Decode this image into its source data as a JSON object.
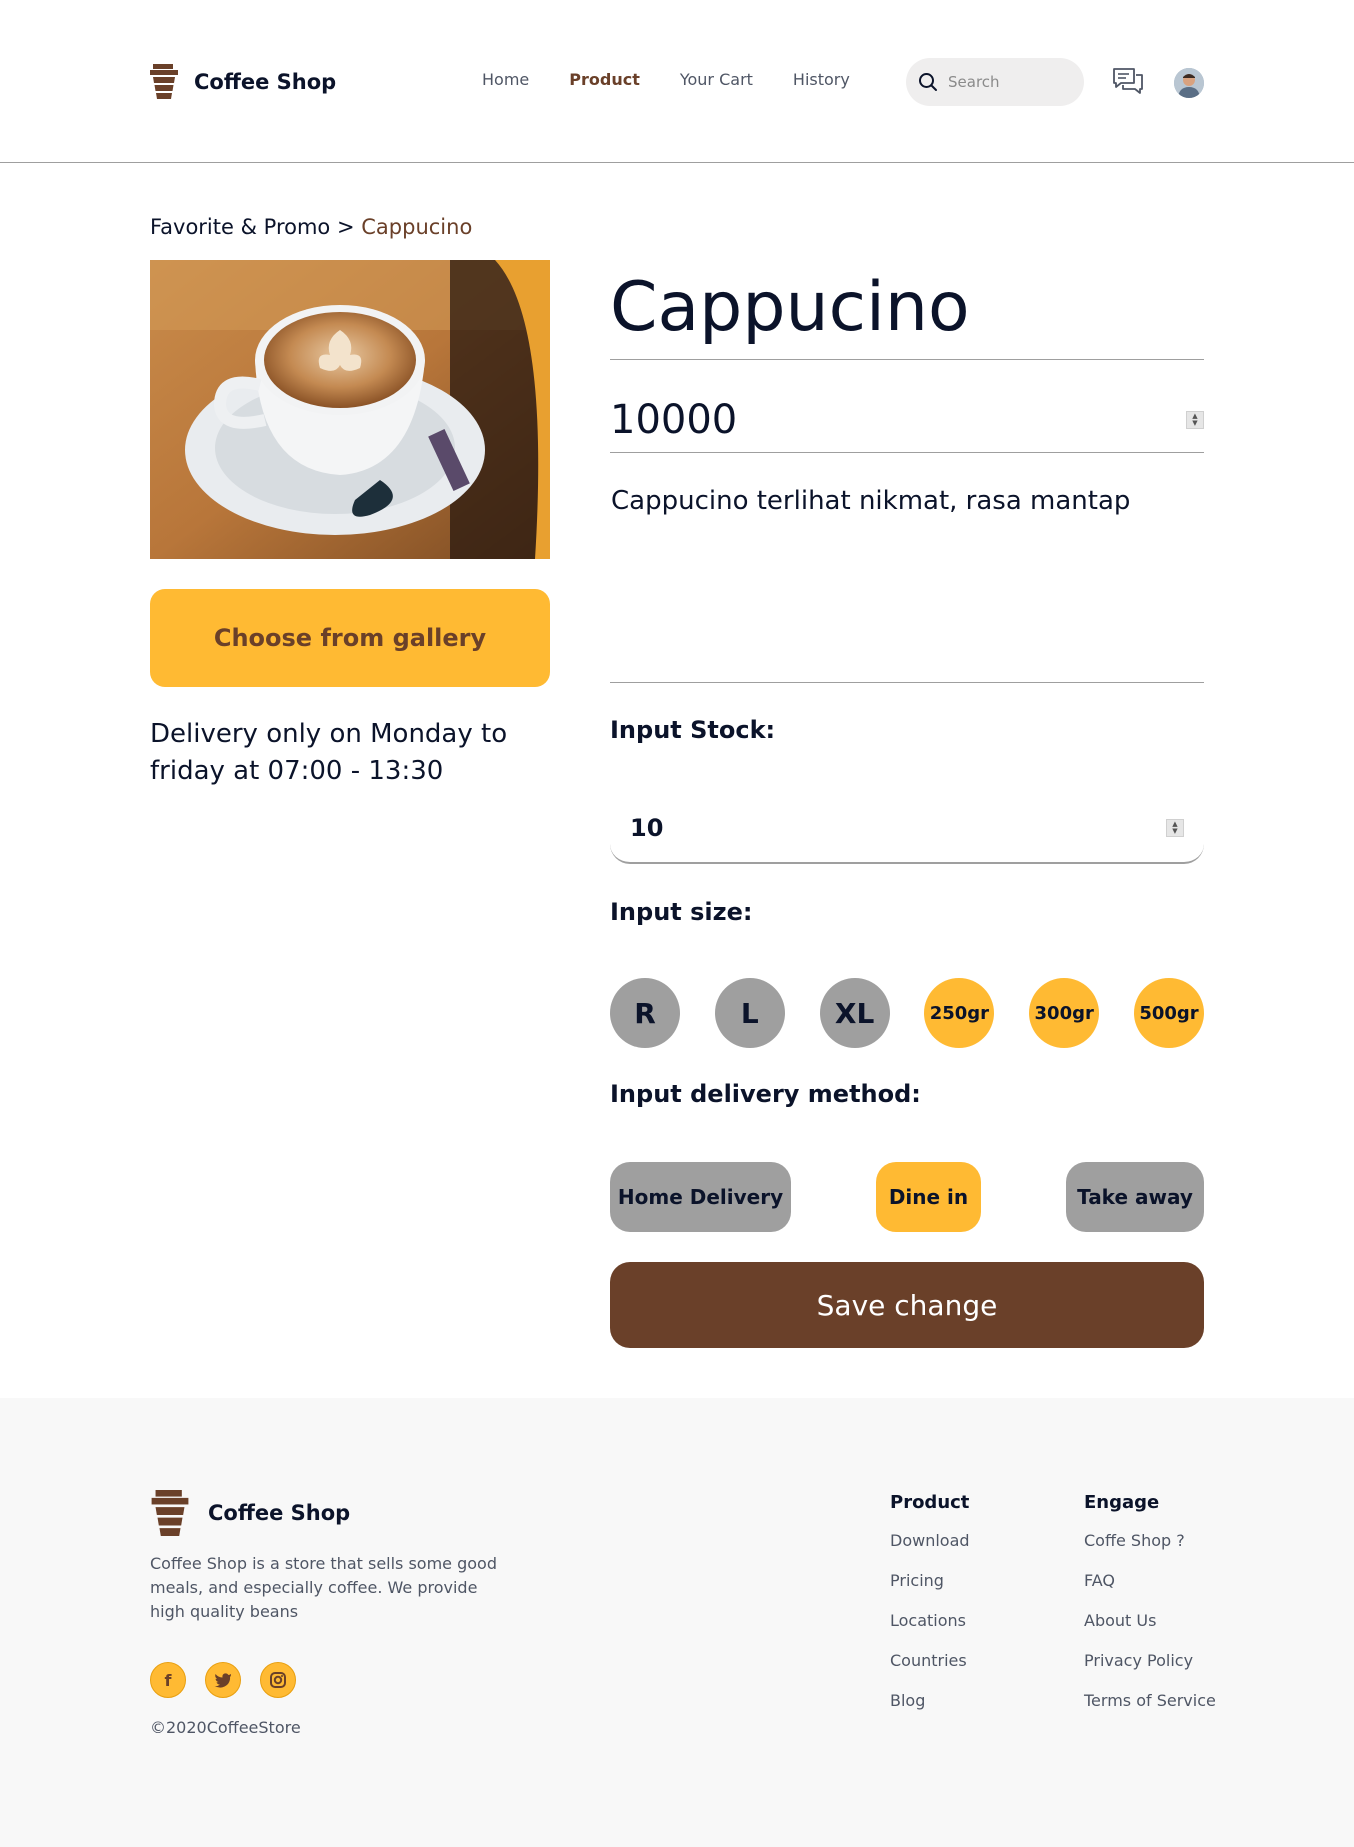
{
  "header": {
    "brand": "Coffee Shop",
    "nav": [
      {
        "label": "Home",
        "active": false
      },
      {
        "label": "Product",
        "active": true
      },
      {
        "label": "Your Cart",
        "active": false
      },
      {
        "label": "History",
        "active": false
      }
    ],
    "search_placeholder": "Search"
  },
  "breadcrumb": {
    "parent": "Favorite & Promo",
    "separator": ">",
    "current": "Cappucino"
  },
  "product": {
    "name": "Cappucino",
    "price": "10000",
    "description": "Cappucino terlihat nikmat, rasa mantap",
    "gallery_button": "Choose from gallery",
    "delivery_note": "Delivery only on Monday to friday at 07:00 - 13:30"
  },
  "stock": {
    "label": "Input Stock:",
    "value": "10"
  },
  "sizes": {
    "label": "Input size:",
    "options": [
      {
        "label": "R",
        "selected": false
      },
      {
        "label": "L",
        "selected": false
      },
      {
        "label": "XL",
        "selected": false
      },
      {
        "label": "250gr",
        "selected": true
      },
      {
        "label": "300gr",
        "selected": true
      },
      {
        "label": "500gr",
        "selected": true
      }
    ]
  },
  "delivery": {
    "label": "Input delivery method:",
    "options": [
      {
        "label": "Home Delivery",
        "selected": false
      },
      {
        "label": "Dine in",
        "selected": true
      },
      {
        "label": "Take away",
        "selected": false
      }
    ]
  },
  "save_button": "Save change",
  "footer": {
    "brand": "Coffee Shop",
    "description": "Coffee Shop is a store that sells some good meals, and especially coffee. We provide high quality beans",
    "socials": [
      "facebook-icon",
      "twitter-icon",
      "instagram-icon"
    ],
    "copyright": "©2020CoffeeStore",
    "columns": [
      {
        "title": "Product",
        "links": [
          "Download",
          "Pricing",
          "Locations",
          "Countries",
          "Blog"
        ]
      },
      {
        "title": "Engage",
        "links": [
          "Coffe Shop ?",
          "FAQ",
          "About Us",
          "Privacy Policy",
          "Terms of Service"
        ]
      }
    ]
  },
  "colors": {
    "brown": "#6a4029",
    "yellow": "#ffba33",
    "grey": "#9f9f9f",
    "dark": "#0b132a"
  }
}
